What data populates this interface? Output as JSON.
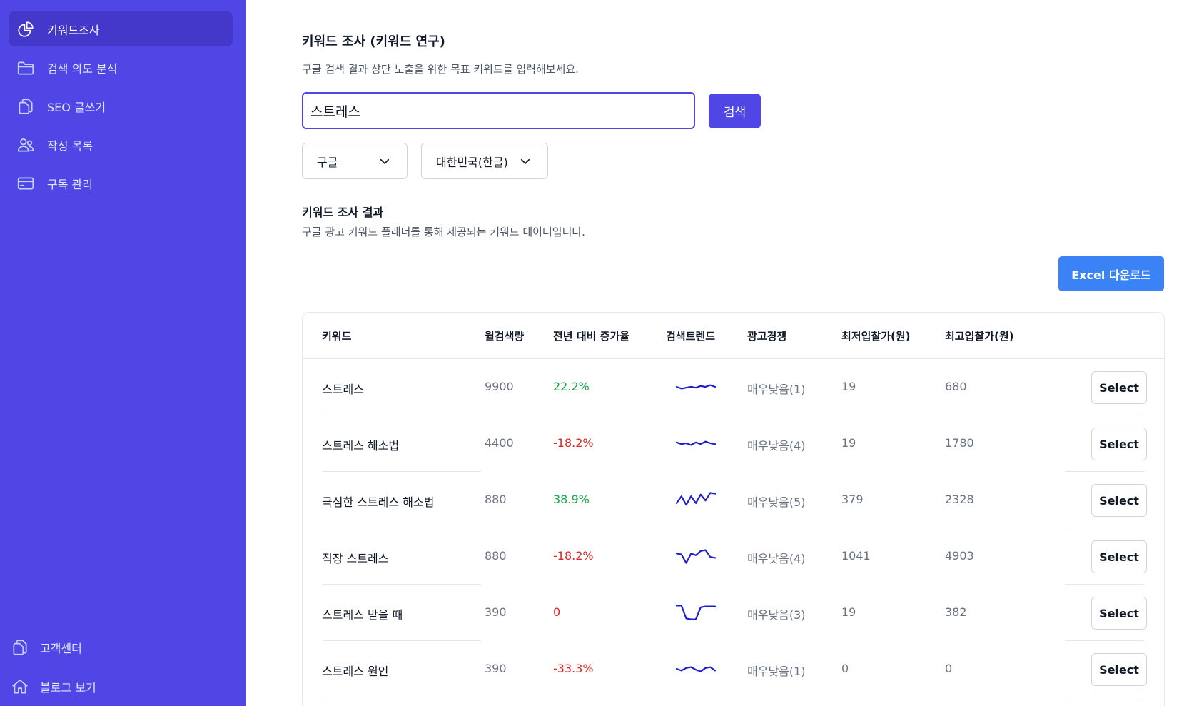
{
  "sidebar": {
    "nav": [
      {
        "label": "키워드조사",
        "icon": "pie-chart-icon",
        "active": true
      },
      {
        "label": "검색 의도 분석",
        "icon": "folder-icon",
        "active": false
      },
      {
        "label": "SEO 글쓰기",
        "icon": "documents-icon",
        "active": false
      },
      {
        "label": "작성 목록",
        "icon": "users-icon",
        "active": false
      },
      {
        "label": "구독 관리",
        "icon": "credit-card-icon",
        "active": false
      }
    ],
    "bottom": [
      {
        "label": "고객센터",
        "icon": "documents-icon"
      },
      {
        "label": "블로그 보기",
        "icon": "home-icon"
      }
    ]
  },
  "main": {
    "title": "키워드 조사 (키워드 연구)",
    "subtitle": "구글 검색 결과 상단 노출을 위한 목표 키워드를 입력해보세요.",
    "search": {
      "value": "스트레스",
      "button_label": "검색"
    },
    "engine_select": {
      "value": "구글",
      "icon": "chevron-down-icon"
    },
    "region_select": {
      "value": "대한민국(한글)",
      "icon": "chevron-down-icon"
    },
    "results_title": "키워드 조사 결과",
    "results_subtitle": "구글 광고 키워드 플래너를 통해 제공되는 키워드 데이터입니다.",
    "excel_button": "Excel 다운로드"
  },
  "table": {
    "headers": [
      "키워드",
      "월검색량",
      "전년 대비 증가율",
      "검색트렌드",
      "광고경쟁",
      "최저입찰가(원)",
      "최고입찰가(원)"
    ],
    "select_label": "Select",
    "colors": {
      "positive": "#16a34a",
      "negative": "#dc2626",
      "trend": "#1d1dcc"
    },
    "rows": [
      {
        "keyword": "스트레스",
        "volume": "9900",
        "growth": "22.2%",
        "growth_sign": "pos",
        "trend": [
          0.5,
          0.6,
          0.55,
          0.5,
          0.55,
          0.45,
          0.5,
          0.4,
          0.5
        ],
        "competition": "매우낮음(1)",
        "min_bid": "19",
        "max_bid": "680"
      },
      {
        "keyword": "스트레스 해소법",
        "volume": "4400",
        "growth": "-18.2%",
        "growth_sign": "neg",
        "trend": [
          0.45,
          0.55,
          0.5,
          0.6,
          0.45,
          0.55,
          0.4,
          0.5,
          0.55
        ],
        "competition": "매우낮음(4)",
        "min_bid": "19",
        "max_bid": "1780"
      },
      {
        "keyword": "극심한 스트레스 해소법",
        "volume": "880",
        "growth": "38.9%",
        "growth_sign": "pos",
        "trend": [
          0.7,
          0.3,
          0.8,
          0.3,
          0.7,
          0.2,
          0.55,
          0.1,
          0.15
        ],
        "competition": "매우낮음(5)",
        "min_bid": "379",
        "max_bid": "2328"
      },
      {
        "keyword": "직장 스트레스",
        "volume": "880",
        "growth": "-18.2%",
        "growth_sign": "neg",
        "trend": [
          0.35,
          0.4,
          0.9,
          0.35,
          0.45,
          0.2,
          0.15,
          0.55,
          0.6
        ],
        "competition": "매우낮음(4)",
        "min_bid": "1041",
        "max_bid": "4903"
      },
      {
        "keyword": "스트레스 받을 때",
        "volume": "390",
        "growth": "0",
        "growth_sign": "neg",
        "trend": [
          0.1,
          0.1,
          0.85,
          0.9,
          0.9,
          0.2,
          0.15,
          0.15,
          0.15
        ],
        "competition": "매우낮음(3)",
        "min_bid": "19",
        "max_bid": "382"
      },
      {
        "keyword": "스트레스 원인",
        "volume": "390",
        "growth": "-33.3%",
        "growth_sign": "neg",
        "trend": [
          0.5,
          0.6,
          0.45,
          0.4,
          0.55,
          0.65,
          0.45,
          0.4,
          0.6
        ],
        "competition": "매우낮음(1)",
        "min_bid": "0",
        "max_bid": "0"
      }
    ]
  }
}
